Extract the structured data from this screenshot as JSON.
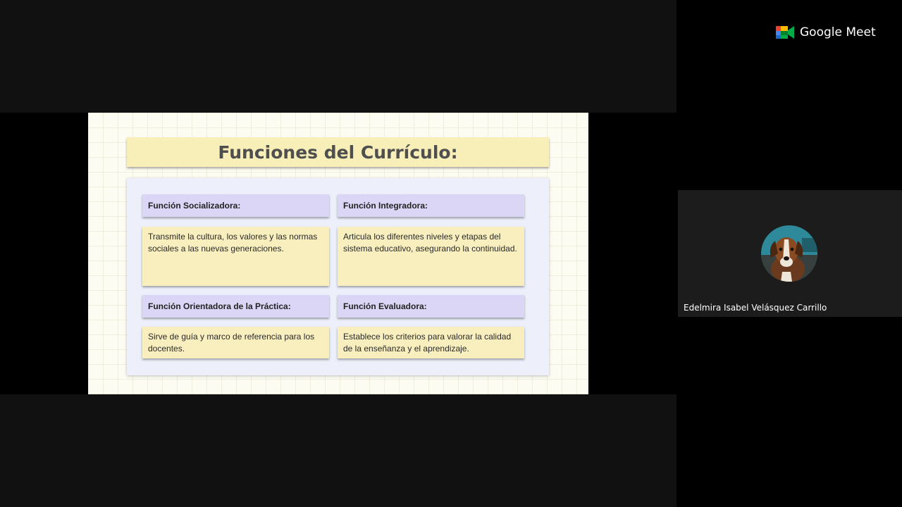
{
  "app": {
    "name": "Google Meet"
  },
  "presentation": {
    "title": "Funciones del Currículo:",
    "functions": [
      {
        "heading": "Función Socializadora:",
        "description": "Transmite la cultura, los valores y las normas sociales a las nuevas generaciones."
      },
      {
        "heading": "Función Integradora:",
        "description": "Articula los diferentes niveles y etapas del sistema educativo, asegurando la continuidad."
      },
      {
        "heading": "Función Orientadora de la Práctica:",
        "description": "Sirve de guía y marco de referencia para los docentes."
      },
      {
        "heading": "Función Evaluadora:",
        "description": "Establece los criterios para valorar la calidad de la enseñanza y el aprendizaje."
      }
    ]
  },
  "participant": {
    "name": "Edelmira Isabel Velásquez Carrillo",
    "avatar_icon": "dog-photo-avatar"
  },
  "colors": {
    "meet_green": "#00ac47",
    "meet_blue": "#4285f4",
    "meet_yellow": "#ffba00",
    "meet_red": "#ea4335",
    "title_fill": "#f8eeb8",
    "heading_fill": "#dcd6f6",
    "body_fill": "#f8eebe",
    "panel_fill": "#edf0fb"
  }
}
